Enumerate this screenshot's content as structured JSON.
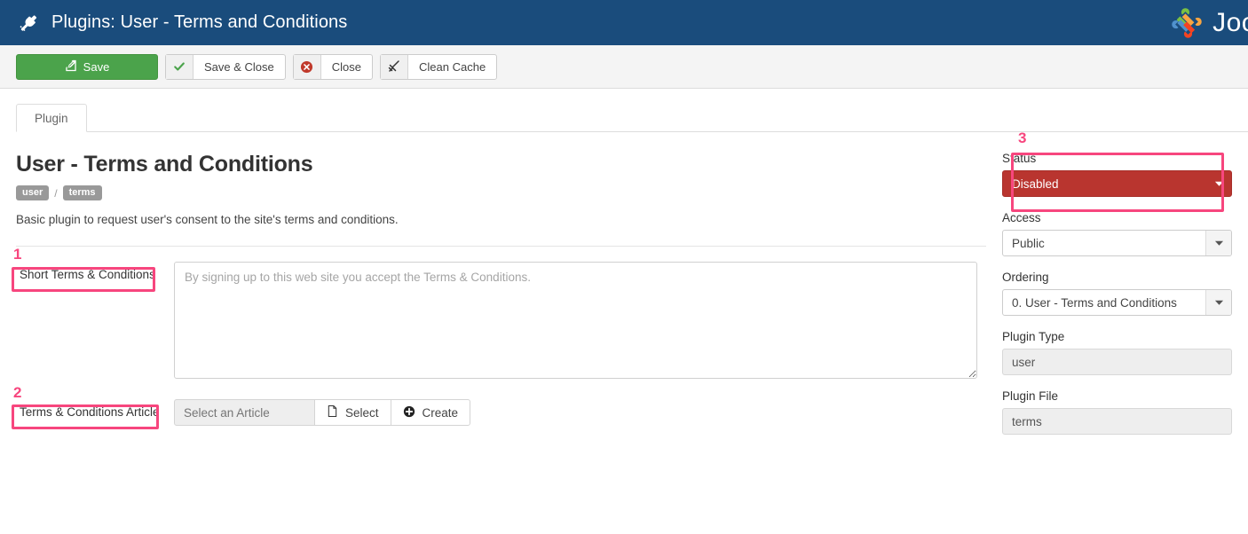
{
  "header": {
    "icon": "plug-icon",
    "title": "Plugins: User - Terms and Conditions",
    "brand_text": "Joo",
    "brand_logo": "joomla-logo",
    "bg_color": "#1a4c7c"
  },
  "toolbar": {
    "save_label": "Save",
    "save_icon": "pencil-square-icon",
    "save_close_label": "Save & Close",
    "save_close_icon": "check-icon",
    "close_label": "Close",
    "close_icon": "circle-x-icon",
    "clean_cache_label": "Clean Cache",
    "clean_cache_icon": "broom-icon",
    "save_color": "#4ba34b"
  },
  "tabs": [
    {
      "label": "Plugin",
      "active": true
    }
  ],
  "main": {
    "title": "User - Terms and Conditions",
    "badges": [
      "user",
      "terms"
    ],
    "badge_separator": "/",
    "description": "Basic plugin to request user's consent to the site's terms and conditions.",
    "fields": [
      {
        "label": "Short Terms & Conditions",
        "type": "textarea",
        "value": "",
        "placeholder": "By signing up to this web site you accept the Terms & Conditions."
      },
      {
        "label": "Terms & Conditions Article",
        "type": "input-group",
        "value": "",
        "placeholder": "Select an Article",
        "buttons": [
          {
            "label": "Select",
            "icon": "file-icon"
          },
          {
            "label": "Create",
            "icon": "plus-circle-icon"
          }
        ]
      }
    ]
  },
  "sidebar": {
    "fields": [
      {
        "label": "Status",
        "type": "select",
        "value": "Disabled",
        "variant": "danger",
        "icon": "chevron-down-icon"
      },
      {
        "label": "Access",
        "type": "select",
        "value": "Public",
        "variant": "default",
        "icon": "chevron-down-icon"
      },
      {
        "label": "Ordering",
        "type": "select",
        "value": "0. User - Terms and Conditions",
        "variant": "default",
        "icon": "chevron-down-icon"
      },
      {
        "label": "Plugin Type",
        "type": "readonly",
        "value": "user"
      },
      {
        "label": "Plugin File",
        "type": "readonly",
        "value": "terms"
      }
    ]
  },
  "annotations": {
    "color": "#f7467e",
    "markers": [
      {
        "number": "1",
        "target": "short-terms-and-conditions-label"
      },
      {
        "number": "2",
        "target": "terms-and-conditions-article-label"
      },
      {
        "number": "3",
        "target": "status-field-group"
      }
    ]
  }
}
